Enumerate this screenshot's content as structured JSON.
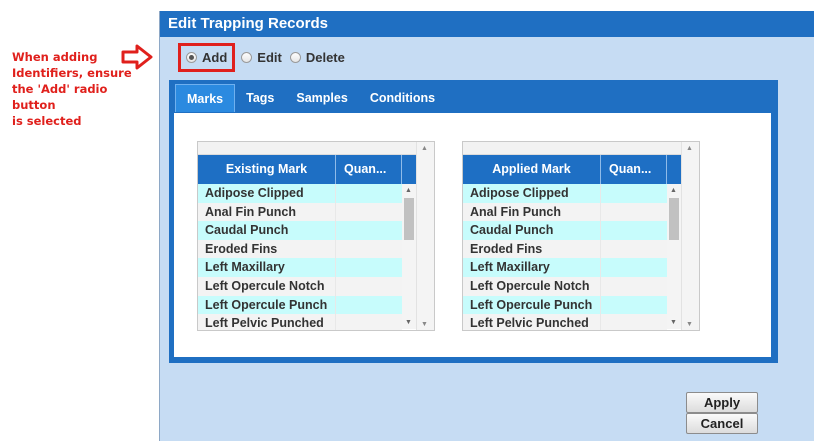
{
  "annotation": {
    "lines": [
      "When adding",
      "Identifiers, ensure",
      "the 'Add' radio button",
      "is selected"
    ]
  },
  "dialog": {
    "title": "Edit Trapping Records",
    "modes": [
      {
        "label": "Add",
        "checked": true
      },
      {
        "label": "Edit",
        "checked": false
      },
      {
        "label": "Delete",
        "checked": false
      }
    ],
    "tabs": [
      "Marks",
      "Tags",
      "Samples",
      "Conditions"
    ],
    "active_tab": "Marks",
    "existing_grid": {
      "col1": "Existing Mark",
      "col2": "Quan...",
      "rows": [
        "Adipose Clipped",
        "Anal Fin Punch",
        "Caudal Punch",
        "Eroded Fins",
        "Left Maxillary",
        "Left Opercule Notch",
        "Left Opercule Punch",
        "Left Pelvic Punched"
      ]
    },
    "applied_grid": {
      "col1": "Applied Mark",
      "col2": "Quan...",
      "rows": [
        "Adipose Clipped",
        "Anal Fin Punch",
        "Caudal Punch",
        "Eroded Fins",
        "Left Maxillary",
        "Left Opercule Notch",
        "Left Opercule Punch",
        "Left Pelvic Punched"
      ]
    },
    "apply_label": "Apply",
    "cancel_label": "Cancel"
  },
  "colors": {
    "titlebar": "#1f6fc2",
    "annotation": "#e0201c",
    "row_highlight": "#c7fcfc"
  }
}
